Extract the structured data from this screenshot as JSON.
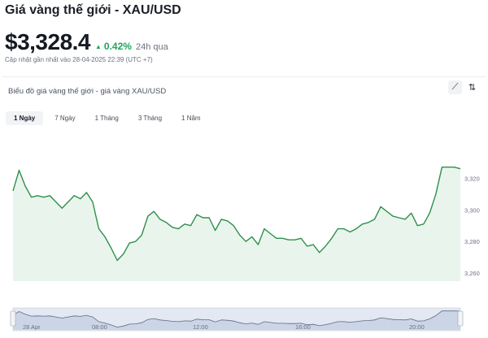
{
  "header": {
    "title": "Giá vàng thế giới - XAU/USD",
    "price": "$3,328.4",
    "change": "0.42%",
    "change_period": "24h qua",
    "updated": "Cập nhật gần nhất vào 28-04-2025 22:39 (UTC +7)"
  },
  "card": {
    "title": "Biểu đồ giá vàng thế giới - giá vàng XAU/USD",
    "tools": [
      {
        "name": "line-chart-icon",
        "glyph": "⟋"
      },
      {
        "name": "candlestick-icon",
        "glyph": "⇅"
      }
    ]
  },
  "tabs": [
    {
      "label": "1 Ngày",
      "active": true
    },
    {
      "label": "7 Ngày",
      "active": false
    },
    {
      "label": "1 Tháng",
      "active": false
    },
    {
      "label": "3 Tháng",
      "active": false
    },
    {
      "label": "1 Năm",
      "active": false
    }
  ],
  "colors": {
    "line": "#2f8f4e",
    "area": "#e9f5ec",
    "up": "#22a35a"
  },
  "chart_data": {
    "type": "area",
    "series": [
      {
        "values": [
          3312,
          3325,
          3315,
          3308,
          3309,
          3308,
          3309,
          3305,
          3301,
          3305,
          3309,
          3307,
          3311,
          3305,
          3288,
          3283,
          3276,
          3268,
          3272,
          3279,
          3280,
          3284,
          3296,
          3299,
          3294,
          3292,
          3289,
          3288,
          3291,
          3290,
          3297,
          3295,
          3295,
          3287,
          3294,
          3293,
          3290,
          3284,
          3280,
          3283,
          3278,
          3288,
          3285,
          3282,
          3282,
          3281,
          3281,
          3282,
          3277,
          3278,
          3273,
          3277,
          3282,
          3288,
          3288,
          3286,
          3288,
          3291,
          3292,
          3294,
          3302,
          3299,
          3296,
          3295,
          3294,
          3298,
          3290,
          3291,
          3298,
          3310,
          3327,
          3327,
          3327,
          3326
        ]
      }
    ],
    "ylim": [
      3258,
      3332
    ],
    "y_ticks": [
      3260,
      3280,
      3300,
      3320
    ],
    "y_tick_labels": [
      "3,260",
      "3,280",
      "3,300",
      "3,320"
    ],
    "x_labels": [
      "28 Apr",
      "08:00",
      "12:00",
      "16:00",
      "20:00"
    ],
    "grid": false
  }
}
